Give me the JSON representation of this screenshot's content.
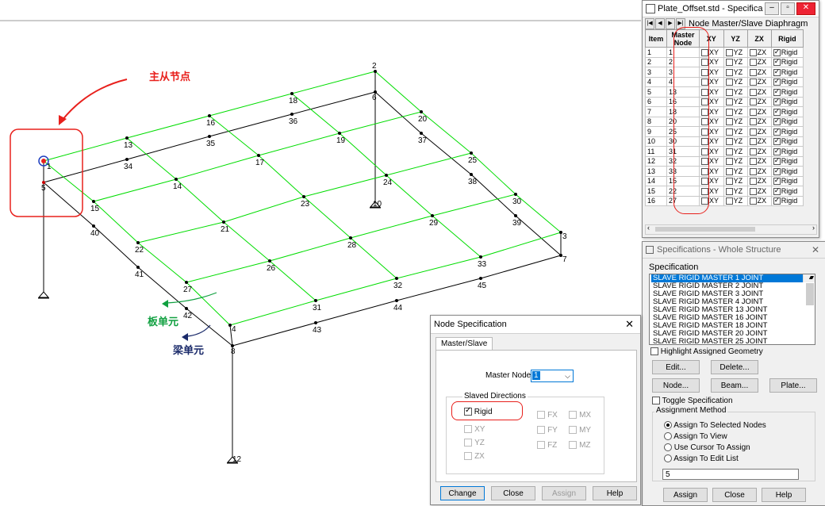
{
  "annotations": {
    "master_slave_node": "主从节点",
    "plate_element": "板单元",
    "beam_element": "梁单元"
  },
  "colors": {
    "plate_lines": "#00dd00",
    "beam_lines": "#000000",
    "annotation_red": "#e8201c",
    "annotation_green": "#10a040",
    "annotation_navy": "#1a2a6a",
    "selection_blue": "#0078d7"
  },
  "node_labels": [
    "1",
    "2",
    "3",
    "4",
    "5",
    "6",
    "7",
    "8",
    "10",
    "12",
    "13",
    "14",
    "15",
    "16",
    "17",
    "18",
    "19",
    "20",
    "21",
    "22",
    "23",
    "24",
    "25",
    "26",
    "27",
    "28",
    "29",
    "30",
    "31",
    "32",
    "33",
    "34",
    "35",
    "36",
    "37",
    "38",
    "39",
    "40",
    "41",
    "42",
    "43",
    "44",
    "45"
  ],
  "table_window": {
    "title": "Plate_Offset.std - Specifica...",
    "tab_title": "Node Master/Slave Diaphragm",
    "columns": [
      "Item",
      "Master\nNode",
      "XY",
      "YZ",
      "ZX",
      "Rigid"
    ],
    "rows": [
      {
        "item": "1",
        "master": "1"
      },
      {
        "item": "2",
        "master": "2"
      },
      {
        "item": "3",
        "master": "3"
      },
      {
        "item": "4",
        "master": "4"
      },
      {
        "item": "5",
        "master": "13"
      },
      {
        "item": "6",
        "master": "16"
      },
      {
        "item": "7",
        "master": "18"
      },
      {
        "item": "8",
        "master": "20"
      },
      {
        "item": "9",
        "master": "25"
      },
      {
        "item": "10",
        "master": "30"
      },
      {
        "item": "11",
        "master": "31"
      },
      {
        "item": "12",
        "master": "32"
      },
      {
        "item": "13",
        "master": "33"
      },
      {
        "item": "14",
        "master": "15"
      },
      {
        "item": "15",
        "master": "22"
      },
      {
        "item": "16",
        "master": "27"
      }
    ],
    "cell_labels": {
      "xy": "XY",
      "yz": "YZ",
      "zx": "ZX",
      "rigid": "Rigid"
    }
  },
  "spec_panel": {
    "title": "Specifications - Whole Structure",
    "section_label": "Specification",
    "list_items": [
      "SLAVE RIGID MASTER 1 JOINT",
      "SLAVE RIGID MASTER 2 JOINT",
      "SLAVE RIGID MASTER 3 JOINT",
      "SLAVE RIGID MASTER 4 JOINT",
      "SLAVE RIGID MASTER 13 JOINT",
      "SLAVE RIGID MASTER 16 JOINT",
      "SLAVE RIGID MASTER 18 JOINT",
      "SLAVE RIGID MASTER 20 JOINT",
      "SLAVE RIGID MASTER 25 JOINT"
    ],
    "highlight_label": "Highlight Assigned Geometry",
    "edit_label": "Edit...",
    "delete_label": "Delete...",
    "node_label": "Node...",
    "beam_label": "Beam...",
    "plate_label": "Plate...",
    "toggle_label": "Toggle Specification",
    "assignment_method_label": "Assignment Method",
    "radio_options": [
      "Assign To Selected Nodes",
      "Assign To View",
      "Use Cursor To Assign",
      "Assign To Edit List"
    ],
    "edit_list_value": "5",
    "assign_label": "Assign",
    "close_label": "Close",
    "help_label": "Help"
  },
  "node_dialog": {
    "title": "Node Specification",
    "tab_label": "Master/Slave",
    "master_node_label": "Master Node",
    "master_node_value": "1",
    "slaved_directions_label": "Slaved Directions",
    "rigid_label": "Rigid",
    "dir_left": [
      "XY",
      "YZ",
      "ZX"
    ],
    "dir_mid": [
      "FX",
      "FY",
      "FZ"
    ],
    "dir_right": [
      "MX",
      "MY",
      "MZ"
    ],
    "change_label": "Change",
    "close_label": "Close",
    "assign_label": "Assign",
    "help_label": "Help"
  }
}
